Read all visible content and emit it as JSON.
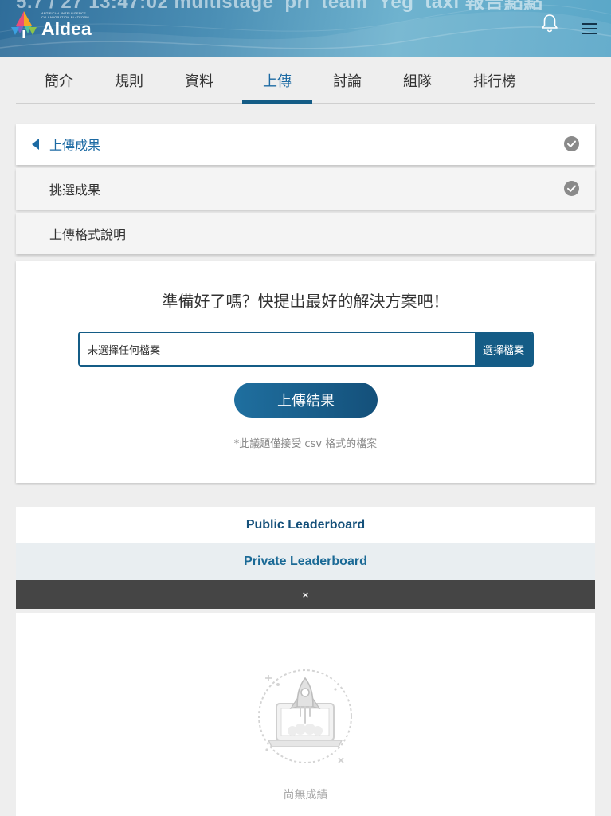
{
  "header": {
    "cut_title": "5.7 / 27 13:47:02 multistage_pri_team_Yeg_taxi  報告點點",
    "logo": {
      "tagline_1": "ARTIFICIAL INTELLIGENCE",
      "tagline_2": "CO-LABORATION PLATFORM",
      "name": "AIdea"
    },
    "icons": {
      "notifications": "bell-icon",
      "menu": "hamburger-menu-icon"
    }
  },
  "tabs": [
    {
      "label": "簡介",
      "active": false
    },
    {
      "label": "規則",
      "active": false
    },
    {
      "label": "資料",
      "active": false
    },
    {
      "label": "上傳",
      "active": true
    },
    {
      "label": "討論",
      "active": false
    },
    {
      "label": "組隊",
      "active": false
    },
    {
      "label": "排行榜",
      "active": false
    }
  ],
  "steps": [
    {
      "label": "上傳成果",
      "active": true,
      "done": true
    },
    {
      "label": "挑選成果",
      "active": false,
      "done": true
    },
    {
      "label": "上傳格式說明",
      "active": false,
      "done": false
    }
  ],
  "upload": {
    "title": "準備好了嗎？快提出最好的解決方案吧！",
    "file_status": "未選擇任何檔案",
    "choose_file": "選擇檔案",
    "submit": "上傳結果",
    "note": "*此議題僅接受 csv 格式的檔案"
  },
  "leaderboard": {
    "public": "Public Leaderboard",
    "private": "Private Leaderboard",
    "active": "private",
    "close": "×",
    "empty_text": "尚無成績",
    "empty_icon": "rocket-laptop-icon"
  },
  "colors": {
    "brand": "#145c86",
    "active_tab": "#1c6aa3",
    "check": "#888888",
    "bar": "#454545"
  }
}
